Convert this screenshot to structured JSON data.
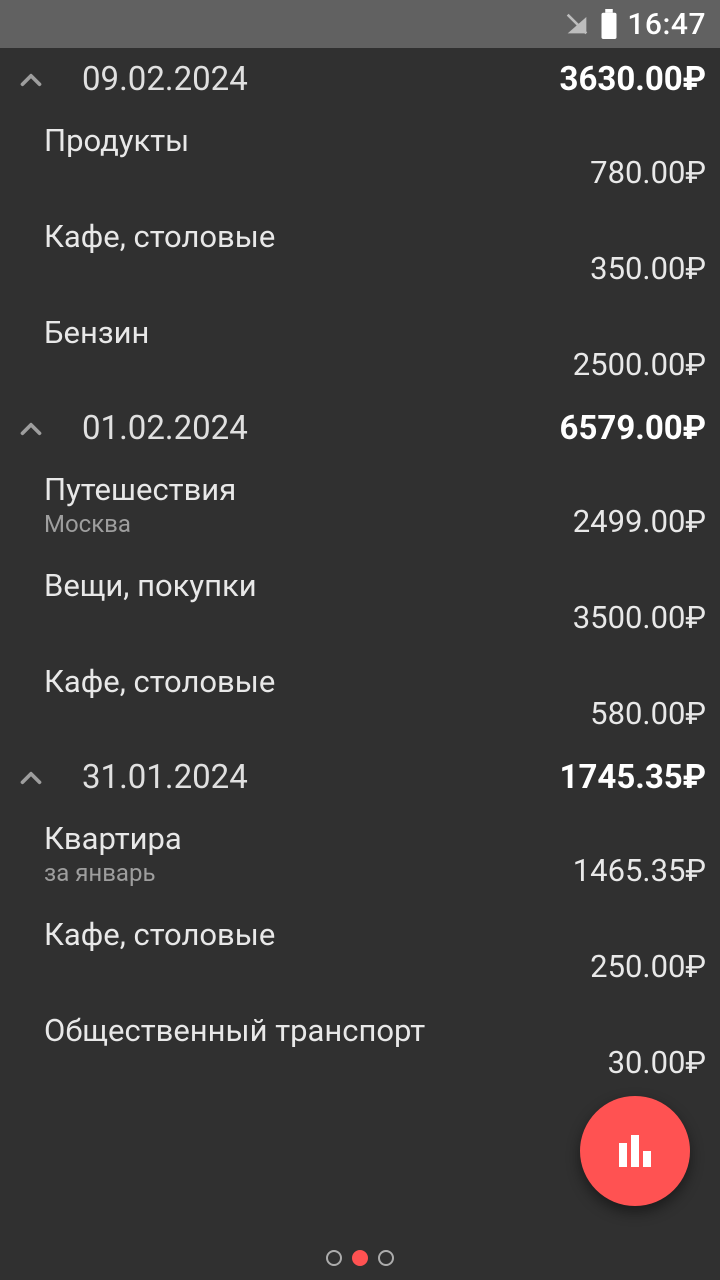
{
  "status": {
    "time": "16:47"
  },
  "currency": "₽",
  "days": [
    {
      "date": "09.02.2024",
      "total": "3630.00₽",
      "items": [
        {
          "title": "Продукты",
          "sub": "",
          "amount": "780.00₽"
        },
        {
          "title": "Кафе, столовые",
          "sub": "",
          "amount": "350.00₽"
        },
        {
          "title": "Бензин",
          "sub": "",
          "amount": "2500.00₽"
        }
      ]
    },
    {
      "date": "01.02.2024",
      "total": "6579.00₽",
      "items": [
        {
          "title": "Путешествия",
          "sub": "Москва",
          "amount": "2499.00₽"
        },
        {
          "title": "Вещи, покупки",
          "sub": "",
          "amount": "3500.00₽"
        },
        {
          "title": "Кафе, столовые",
          "sub": "",
          "amount": "580.00₽"
        }
      ]
    },
    {
      "date": "31.01.2024",
      "total": "1745.35₽",
      "items": [
        {
          "title": "Квартира",
          "sub": "за январь",
          "amount": "1465.35₽"
        },
        {
          "title": "Кафе, столовые",
          "sub": "",
          "amount": "250.00₽"
        },
        {
          "title": "Общественный транспорт",
          "sub": "",
          "amount": "30.00₽"
        }
      ]
    }
  ],
  "pager": {
    "count": 3,
    "active_index": 1
  }
}
